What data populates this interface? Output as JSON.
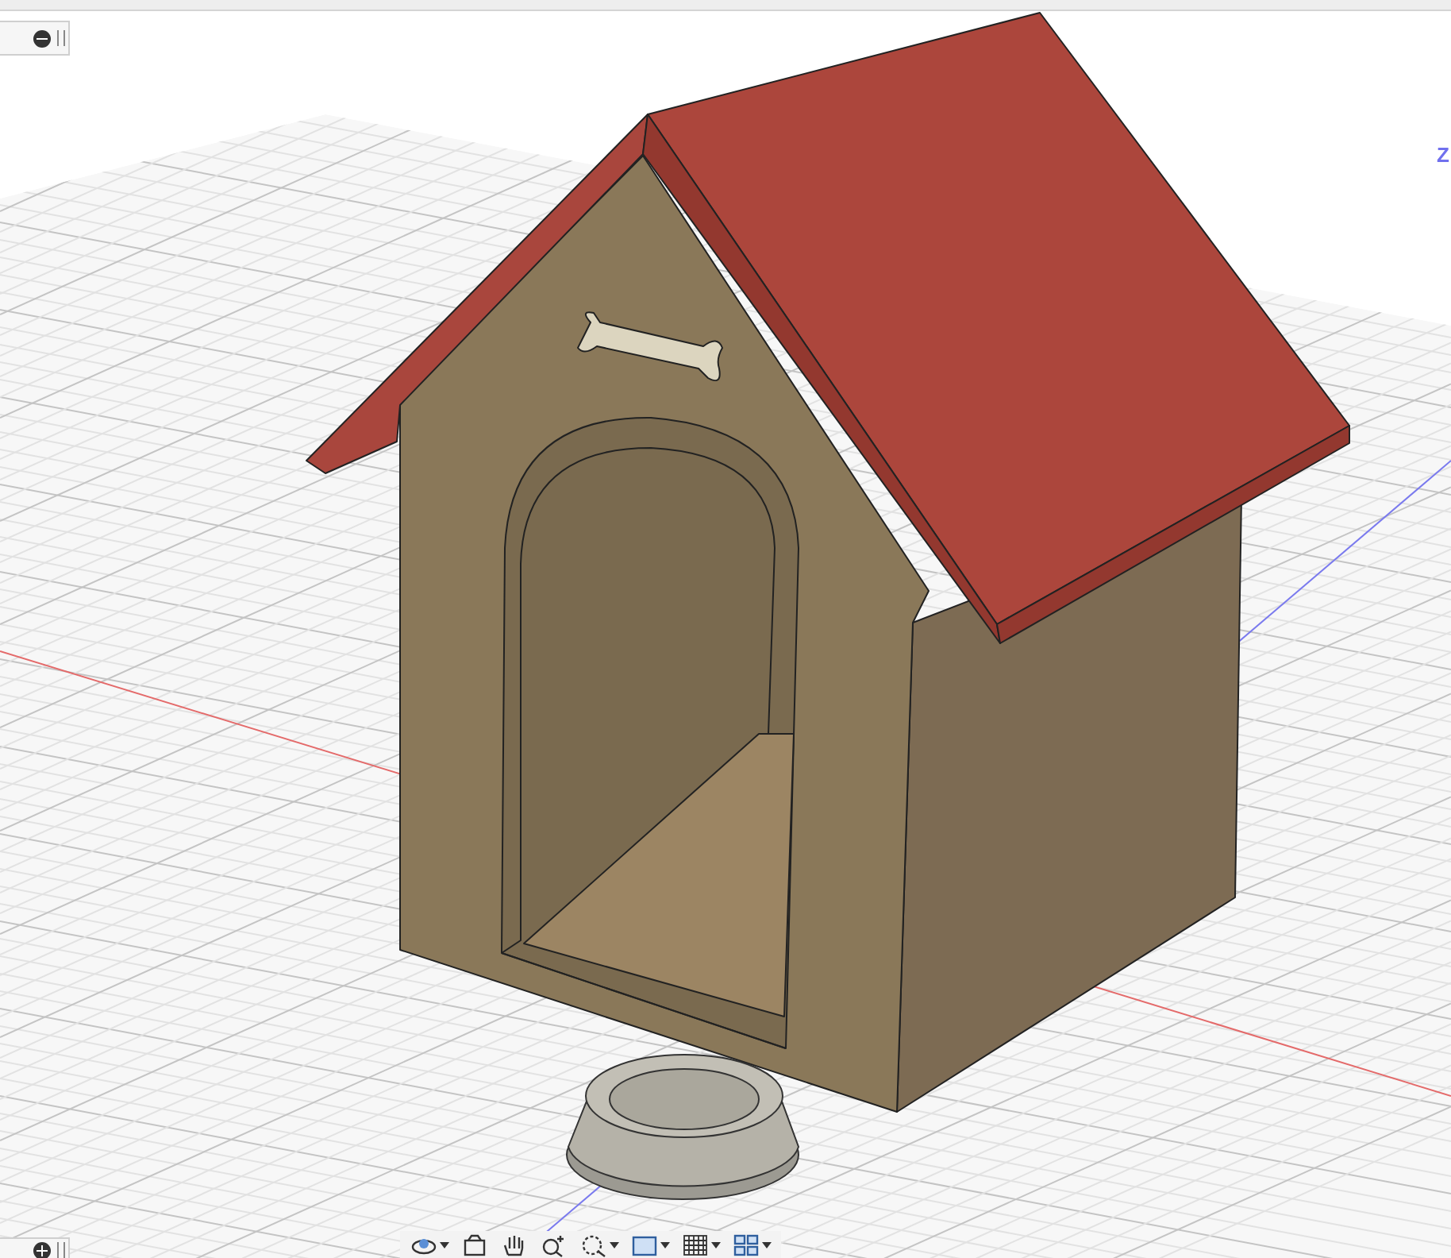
{
  "browser_panel": {
    "expanded": true
  },
  "comments_panel": {
    "expanded": false
  },
  "viewcube": {
    "axis_label": "Z"
  },
  "navigation_bar": {
    "tools": [
      {
        "kind": "orbit",
        "dropdown": true
      },
      {
        "kind": "look-at",
        "dropdown": false
      },
      {
        "kind": "pan",
        "dropdown": false
      },
      {
        "kind": "zoom",
        "dropdown": false
      },
      {
        "kind": "fit",
        "dropdown": true
      },
      {
        "kind": "display",
        "dropdown": true
      },
      {
        "kind": "grid",
        "dropdown": true
      },
      {
        "kind": "viewports",
        "dropdown": true
      }
    ]
  }
}
